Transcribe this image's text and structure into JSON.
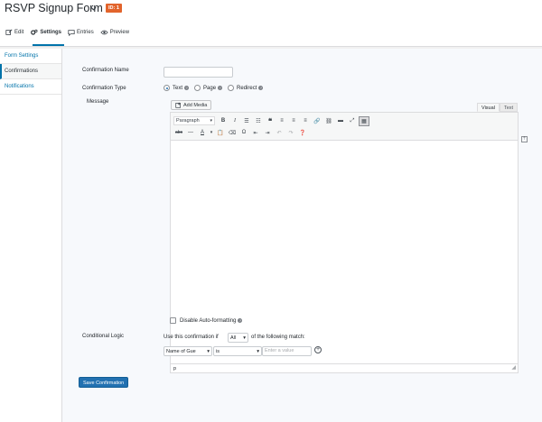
{
  "header": {
    "form_title": "RSVP Signup Form",
    "id_badge": "ID: 1",
    "tabs": [
      {
        "label": "Edit",
        "icon": "edit-icon"
      },
      {
        "label": "Settings",
        "icon": "gear-icon"
      },
      {
        "label": "Entries",
        "icon": "chat-bubble-icon"
      },
      {
        "label": "Preview",
        "icon": "eye-icon"
      }
    ]
  },
  "sidebar": {
    "items": [
      {
        "label": "Form Settings"
      },
      {
        "label": "Confirmations"
      },
      {
        "label": "Notifications"
      }
    ]
  },
  "confirmation": {
    "name_label": "Confirmation Name",
    "name_value": "",
    "type_label": "Confirmation Type",
    "type_options": [
      "Text",
      "Page",
      "Redirect"
    ],
    "type_selected": "Text",
    "message_label": "Message",
    "add_media_label": "Add Media",
    "visual_tab": "Visual",
    "text_tab": "Text",
    "format_select": "Paragraph",
    "status_text": "p",
    "disable_autoformat_label": "Disable Auto-formatting"
  },
  "conditional": {
    "label": "Conditional Logic",
    "prefix_text": "Use this confirmation if",
    "match_value": "All",
    "suffix_text": "of the following match:",
    "field_value": "Name of Gue",
    "operator_value": "is",
    "value_placeholder": "Enter a value"
  },
  "save_button_label": "Save Confirmation",
  "colors": {
    "accent": "#2271b1",
    "badge": "#e2642c"
  }
}
